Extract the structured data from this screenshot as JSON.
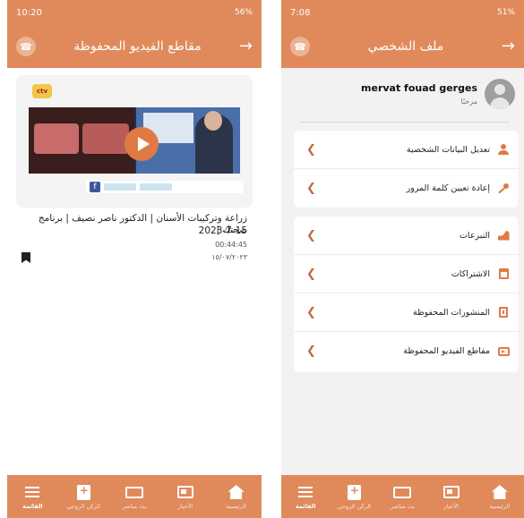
{
  "colors": {
    "accent": "#e08a5b",
    "icon_accent": "#e07a45"
  },
  "left_screen": {
    "status": {
      "time": "10:20",
      "indicators": "56%"
    },
    "header": {
      "title": "مقاطع الفيديو المحفوظة",
      "bell_icon": "bell-icon",
      "forward_icon": "arrow-right-icon"
    },
    "video": {
      "title": "زراعة وتركيبات الأسنان | الدكتور ناصر نصيف | برنامج صحتك |",
      "date": "2023-7-15",
      "duration": "00:44:45",
      "hijri_date": "١٥/٠٧/٢٠٢٣",
      "thumb_logo": "ctv"
    }
  },
  "right_screen": {
    "status": {
      "time": "7:08",
      "indicators": "51%"
    },
    "header": {
      "title": "ملف الشخصي",
      "bell_icon": "bell-icon",
      "forward_icon": "arrow-right-icon"
    },
    "profile": {
      "name": "mervat fouad gerges",
      "greeting": "مرحبًا"
    },
    "menu_account": [
      {
        "label": "تعديل البيانات الشخصية",
        "icon": "user-icon"
      },
      {
        "label": "إعادة تعيين كلمة المرور",
        "icon": "key-icon"
      }
    ],
    "menu_activity": [
      {
        "label": "التبرعات",
        "icon": "donate-icon"
      },
      {
        "label": "الاشتراكات",
        "icon": "subscriptions-icon"
      },
      {
        "label": "المنشورات المحفوظة",
        "icon": "saved-posts-icon"
      },
      {
        "label": "مقاطع الفيديو المحفوظة",
        "icon": "saved-videos-icon"
      }
    ]
  },
  "bottom_nav": [
    {
      "label": "القائمة",
      "icon": "menu-icon",
      "active": true
    },
    {
      "label": "الركن الروحي",
      "icon": "spiritual-corner-icon",
      "active": false
    },
    {
      "label": "بث مباشر",
      "icon": "live-tv-icon",
      "active": false
    },
    {
      "label": "الأخبار",
      "icon": "news-icon",
      "active": false
    },
    {
      "label": "الرئيسية",
      "icon": "home-icon",
      "active": false
    }
  ]
}
